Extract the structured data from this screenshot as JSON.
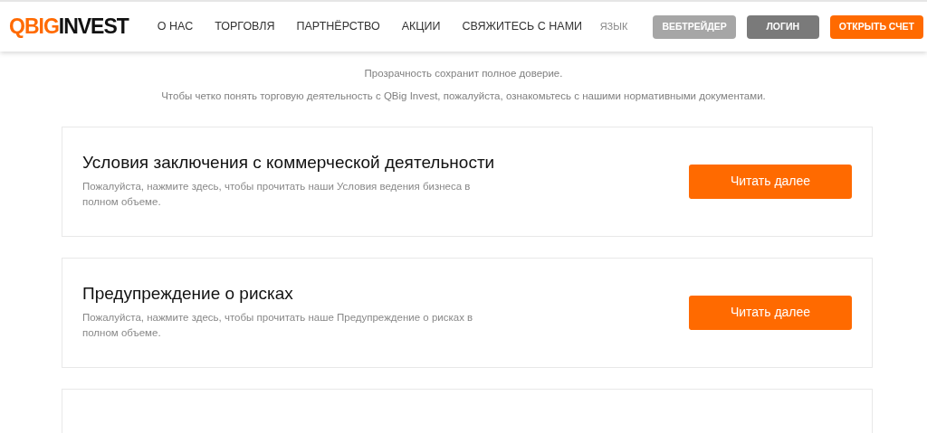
{
  "header": {
    "logo": {
      "accent": "QBIG",
      "rest": "INVEST"
    },
    "nav": [
      "О НАС",
      "ТОРГОВЛЯ",
      "ПАРТНЁРСТВО",
      "АКЦИИ",
      "СВЯЖИТЕСЬ С НАМИ"
    ],
    "language": "ЯЗЫК",
    "buttons": [
      {
        "label": "ВЕБТРЕЙДЕР",
        "kind": "light"
      },
      {
        "label": "ЛОГИН",
        "kind": "dark"
      },
      {
        "label": "ОТКРЫТЬ СЧЕТ",
        "kind": "accent"
      }
    ]
  },
  "intro": [
    "Прозрачность сохранит полное доверие.",
    "Чтобы четко понять торговую деятельность с QBig Invest, пожалуйста, ознакомьтесь с нашими нормативными документами."
  ],
  "documents": [
    {
      "kind": "full",
      "title": "Условия заключения с коммерческой деятельности",
      "description": "Пожалуйста, нажмите здесь, чтобы прочитать наши Условия ведения бизнеса в полном объеме.",
      "button": "Читать далее"
    },
    {
      "kind": "full",
      "title": "Предупреждение о рисках",
      "description": "Пожалуйста, нажмите здесь, чтобы прочитать наше Предупреждение о рисках в полном объеме.",
      "button": "Читать далее"
    },
    {
      "kind": "cut-off"
    }
  ]
}
